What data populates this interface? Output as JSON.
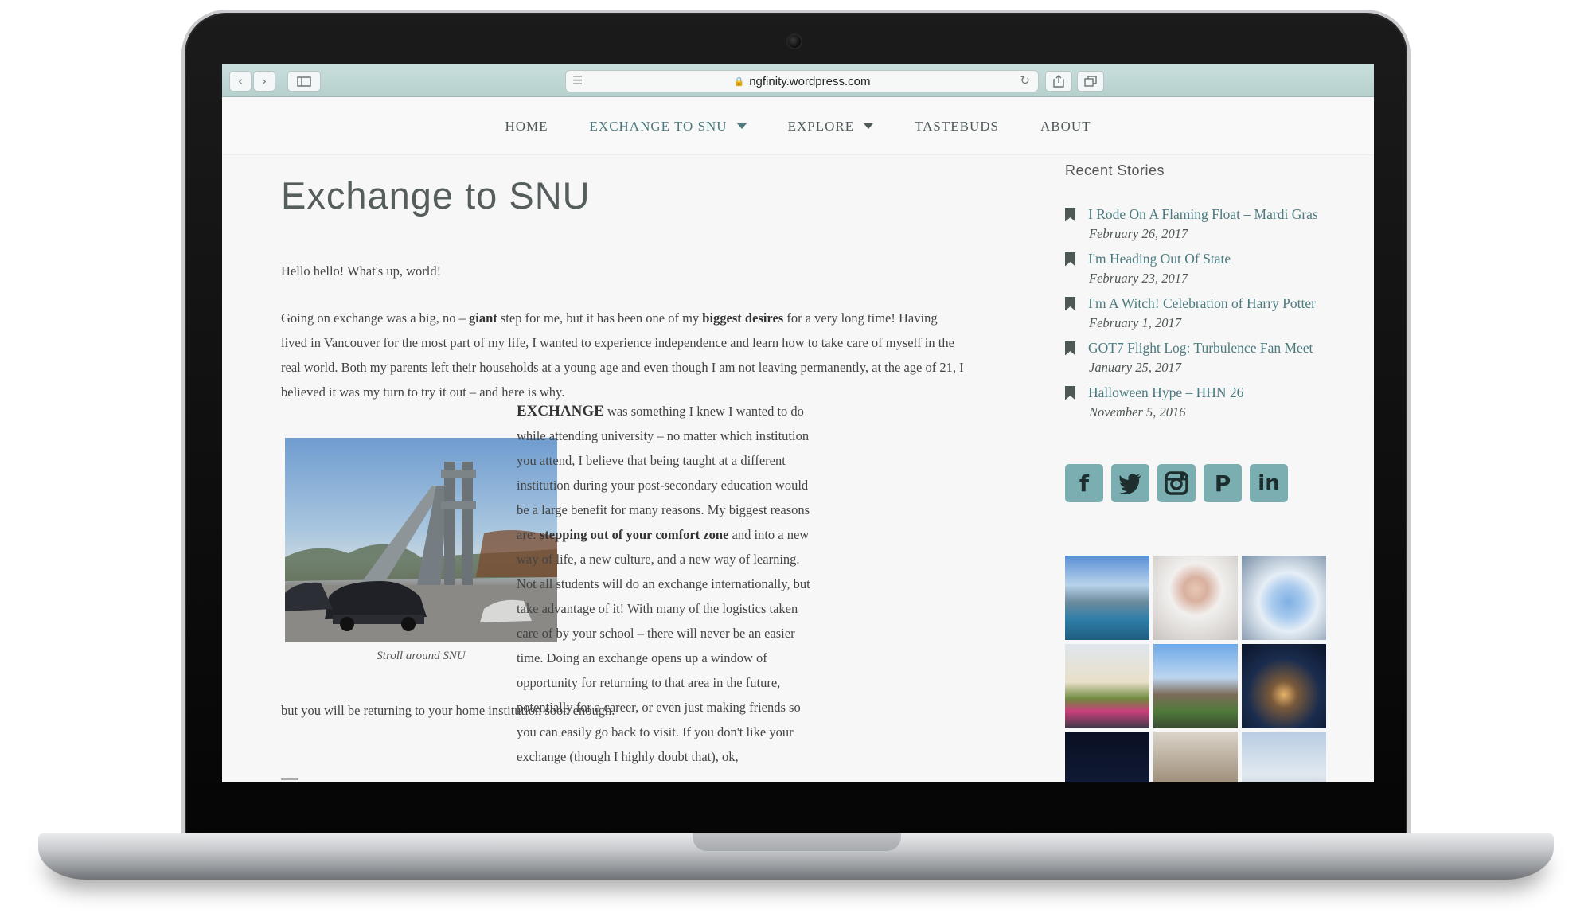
{
  "browser": {
    "url": "ngfinity.wordpress.com"
  },
  "nav": {
    "items": [
      {
        "label": "HOME",
        "dropdown": false,
        "active": false
      },
      {
        "label": "EXCHANGE TO SNU",
        "dropdown": true,
        "active": true
      },
      {
        "label": "EXPLORE",
        "dropdown": true,
        "active": false
      },
      {
        "label": "TASTEBUDS",
        "dropdown": false,
        "active": false
      },
      {
        "label": "ABOUT",
        "dropdown": false,
        "active": false
      }
    ]
  },
  "post": {
    "title": "Exchange to SNU",
    "greeting": "Hello hello! What's up, world!",
    "p1": {
      "a": "Going on exchange was a big, no – ",
      "b": "giant",
      "c": " step for me, but it has been one of my ",
      "d": "biggest desires",
      "e": " for a very long time! Having lived in Vancouver for the most part of my life, I wanted to experience independence and learn how to take care of myself in the real world. Both my parents left their households at a young age and even though I am not leaving permanently, at the age of 21, I believed it was my turn to try it out – and here is why."
    },
    "image_caption": "Stroll around SNU",
    "p2": {
      "a": "EXCHANGE",
      "b": " was something I knew I wanted to do while attending university – no matter which institution you attend, I believe that being taught at a different institution during your post-secondary education would be a large benefit for many reasons. My biggest reasons are: ",
      "c": "stepping out of your comfort zone",
      "d": " and into a new way of life, a new culture, and a new way of learning. Not all students will do an exchange internationally, but take advantage of it! With many of the logistics taken care of by your school – there will never be an easier time. Doing an exchange opens up a window of opportunity for returning to that area in the future, potentially for a career, or even just making friends so you can easily go back to visit. If you don't like your exchange (though I highly doubt that), ok,",
      "tail": "but you will be returning to your home institution soon enough."
    }
  },
  "sidebar": {
    "recent_title": "Recent Stories",
    "stories": [
      {
        "title": "I Rode On A Flaming Float – Mardi Gras",
        "date": "February 26, 2017"
      },
      {
        "title": "I'm Heading Out Of State",
        "date": "February 23, 2017"
      },
      {
        "title": "I'm A Witch! Celebration of Harry Potter",
        "date": "February 1, 2017"
      },
      {
        "title": "GOT7 Flight Log: Turbulence Fan Meet",
        "date": "January 25, 2017"
      },
      {
        "title": "Halloween Hype – HHN 26",
        "date": "November 5, 2016"
      }
    ],
    "social": [
      {
        "icon": "facebook-icon",
        "glyph": "f"
      },
      {
        "icon": "twitter-icon",
        "glyph": "🐦"
      },
      {
        "icon": "instagram-icon",
        "glyph": "◙"
      },
      {
        "icon": "pinterest-icon",
        "glyph": "P"
      },
      {
        "icon": "linkedin-icon",
        "glyph": "in"
      }
    ]
  },
  "colors": {
    "link": "#4b7b80",
    "social_bg": "#7aaeb0",
    "chrome": "#c1d9d7"
  }
}
